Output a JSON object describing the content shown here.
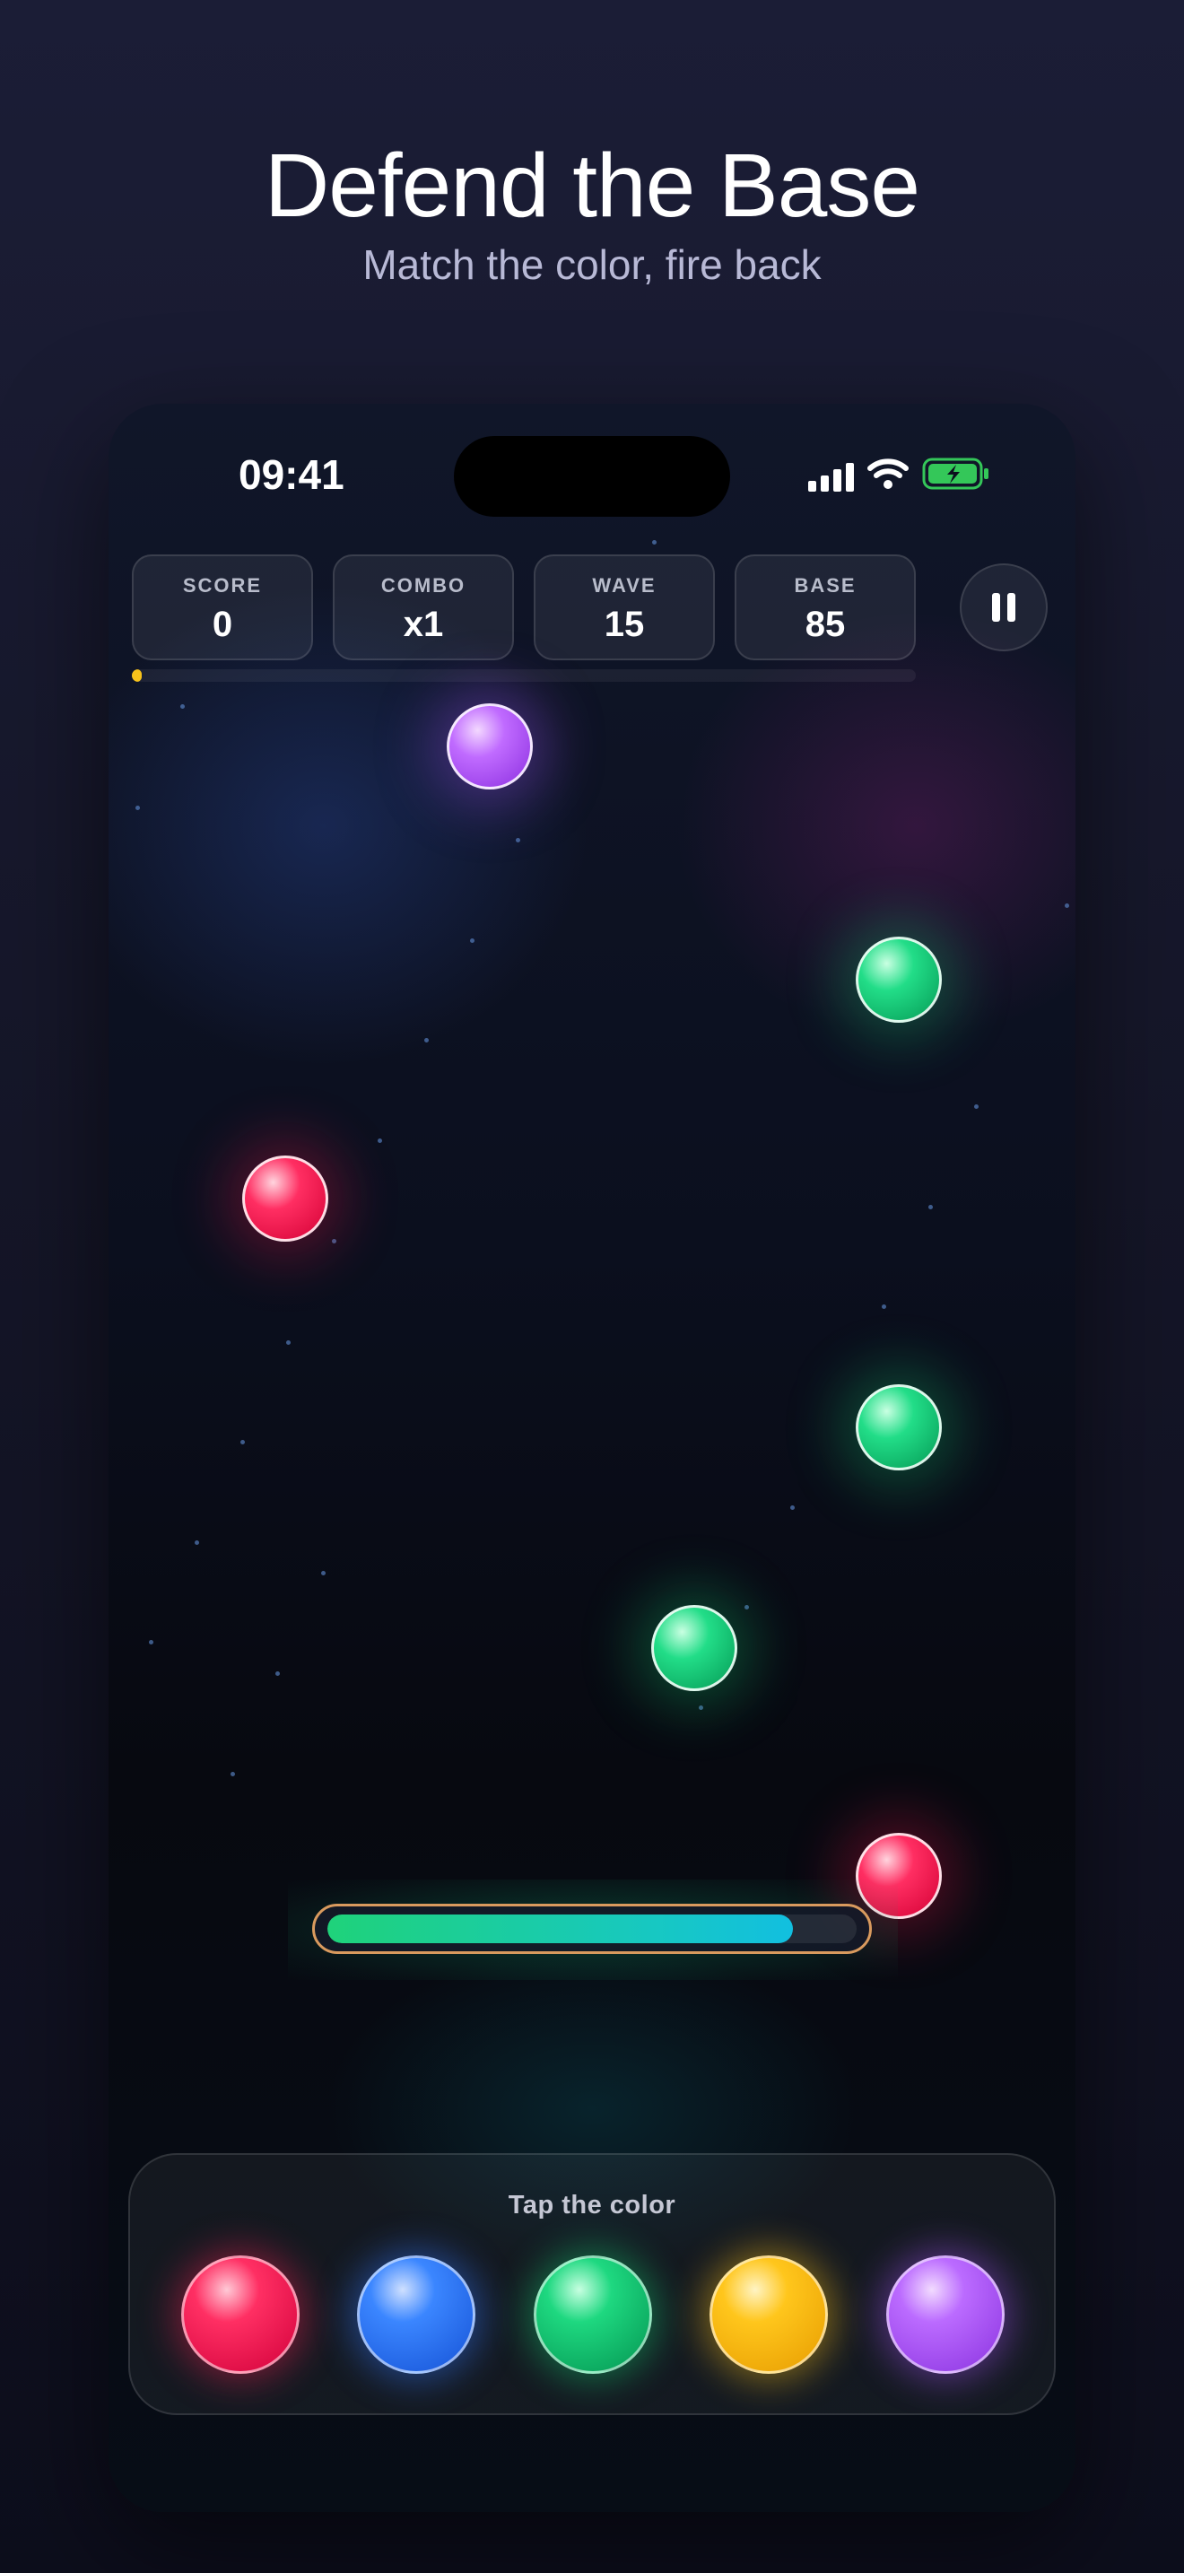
{
  "header": {
    "title": "Defend the Base",
    "subtitle": "Match the color, fire back"
  },
  "status_bar": {
    "time": "09:41",
    "icons": [
      "cellular-signal-icon",
      "wifi-icon",
      "battery-charging-icon"
    ],
    "battery_color": "#34c759"
  },
  "hud": {
    "stats": [
      {
        "label": "SCORE",
        "value": "0"
      },
      {
        "label": "COMBO",
        "value": "x1"
      },
      {
        "label": "WAVE",
        "value": "15"
      },
      {
        "label": "BASE",
        "value": "85"
      }
    ],
    "pause_icon": "pause-icon",
    "wave_progress": 0.01,
    "wave_progress_color": "#f7c21b"
  },
  "enemies": [
    {
      "color": "purple"
    },
    {
      "color": "green"
    },
    {
      "color": "red"
    },
    {
      "color": "green"
    },
    {
      "color": "green"
    },
    {
      "color": "red"
    }
  ],
  "base": {
    "health_fraction": 0.88,
    "border_color": "#d99a5e"
  },
  "controls": {
    "prompt": "Tap the color",
    "colors": [
      {
        "name": "red",
        "hex": "#ff2f63"
      },
      {
        "name": "blue",
        "hex": "#3b86ff"
      },
      {
        "name": "green",
        "hex": "#1ed880"
      },
      {
        "name": "yellow",
        "hex": "#ffc61c"
      },
      {
        "name": "purple",
        "hex": "#bb6bff"
      }
    ]
  }
}
